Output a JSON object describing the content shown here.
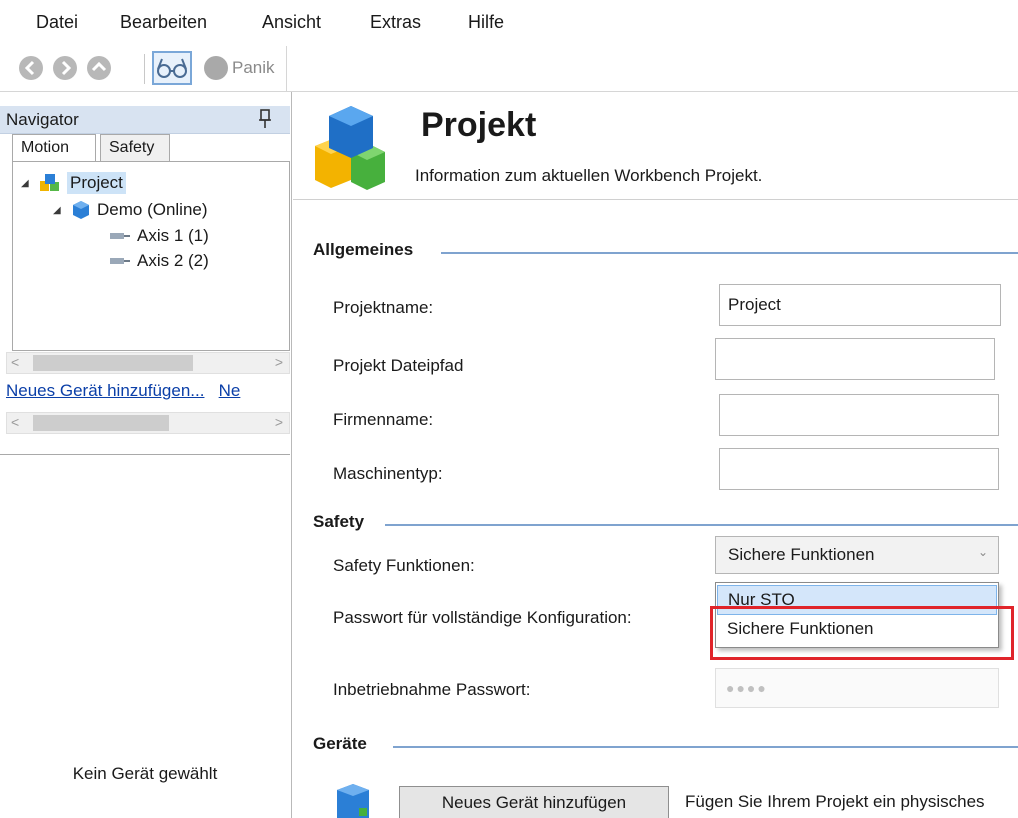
{
  "menu": [
    "Datei",
    "Bearbeiten",
    "Ansicht",
    "Extras",
    "Hilfe"
  ],
  "toolbar": {
    "icons": [
      "back-icon",
      "forward-icon",
      "up-icon",
      "glasses-icon",
      "panic-icon"
    ],
    "panik_label": "Panik"
  },
  "navigator": {
    "title": "Navigator",
    "tabs": [
      "Motion",
      "Safety"
    ],
    "active_tab": "Motion",
    "tree": {
      "project": "Project",
      "device": "Demo (Online)",
      "axes": [
        "Axis 1 (1)",
        "Axis 2 (2)"
      ]
    },
    "links": [
      "Neues Gerät hinzufügen...",
      "Ne"
    ],
    "empty_text": "Kein Gerät gewählt"
  },
  "header": {
    "title": "Projekt",
    "subtitle": "Information zum aktuellen Workbench Projekt."
  },
  "general": {
    "heading": "Allgemeines",
    "project_name_label": "Projektname:",
    "project_name_value": "Project",
    "file_path_label": "Projekt Dateipfad",
    "file_path_value": "",
    "company_label": "Firmenname:",
    "company_value": "",
    "machine_label": "Maschinentyp:",
    "machine_value": ""
  },
  "safety": {
    "heading": "Safety",
    "functions_label": "Safety Funktionen:",
    "functions_selected": "Sichere Funktionen",
    "options": [
      "Nur STO",
      "Sichere Funktionen"
    ],
    "highlighted_option": "Sichere Funktionen",
    "full_config_pw_label": "Passwort für vollständige Konfiguration:",
    "commissioning_pw_label": "Inbetriebnahme Passwort:",
    "commissioning_pw_mask": "●●●●"
  },
  "devices": {
    "heading": "Geräte",
    "add_button": "Neues Gerät hinzufügen",
    "hint": "Fügen Sie Ihrem Projekt ein physisches"
  },
  "colors": {
    "accent": "#7fa3cf",
    "highlight_box": "#e0242a",
    "link": "#0b3fa8",
    "selection": "#cde3f7"
  }
}
